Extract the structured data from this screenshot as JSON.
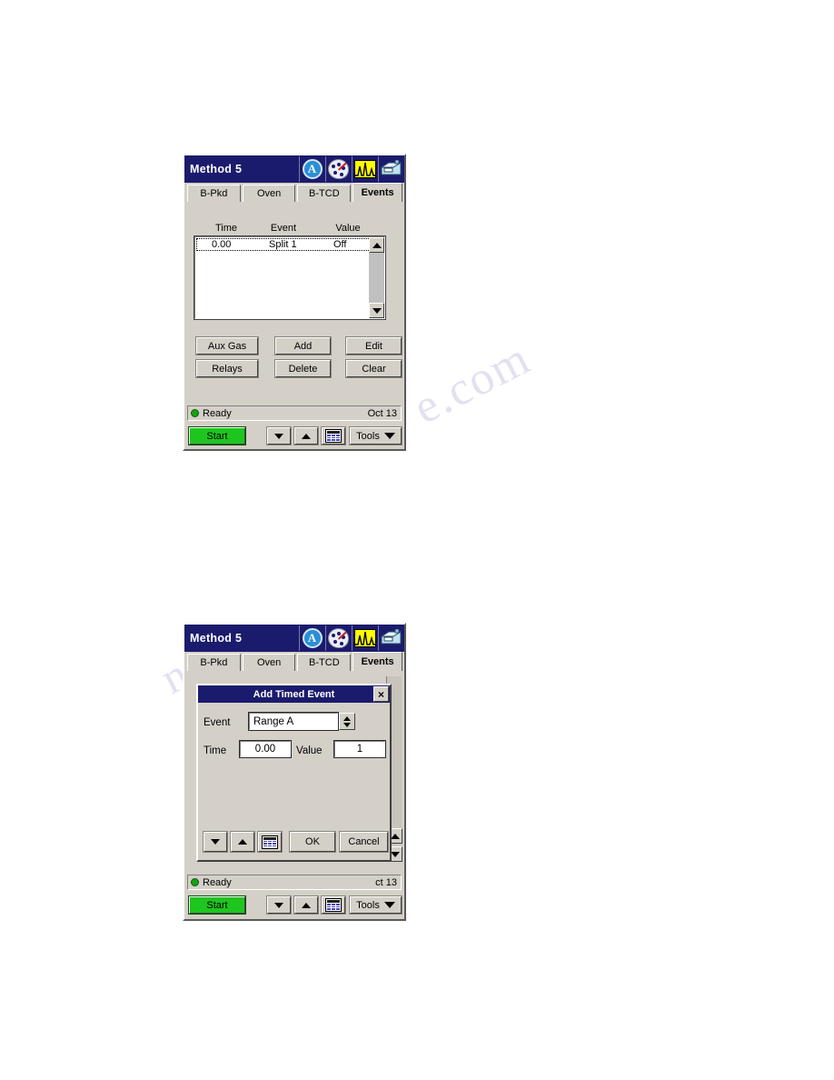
{
  "watermark": {
    "line1": "e.com",
    "line2": "nals"
  },
  "panel_top": {
    "titlebar": {
      "title": "Method 5",
      "icons": [
        {
          "name": "circle-a-icon",
          "glyph": "A"
        },
        {
          "name": "palette-icon",
          "glyph": ""
        },
        {
          "name": "chromatogram-peaks-icon",
          "glyph": ""
        },
        {
          "name": "instrument-icon",
          "glyph": ""
        }
      ]
    },
    "tabs": [
      {
        "label": "B-Pkd",
        "active": false
      },
      {
        "label": "Oven",
        "active": false
      },
      {
        "label": "B-TCD",
        "active": false
      },
      {
        "label": "Events",
        "active": true
      }
    ],
    "table": {
      "headers": [
        "Time",
        "Event",
        "Value"
      ],
      "rows": [
        {
          "time": "0.00",
          "event": "Split 1",
          "value": "Off"
        }
      ]
    },
    "buttons": [
      {
        "label": "Aux Gas"
      },
      {
        "label": "Add"
      },
      {
        "label": "Edit"
      },
      {
        "label": "Relays"
      },
      {
        "label": "Delete"
      },
      {
        "label": "Clear"
      }
    ],
    "status": {
      "text": "Ready",
      "date": "Oct 13",
      "led_color": "#18a018"
    },
    "toolbar": {
      "start_label": "Start",
      "start_color": "#1fc51f",
      "tools_label": "Tools",
      "down_icon": "arrow-down-icon",
      "up_icon": "arrow-up-icon",
      "keypad_icon": "keypad-icon"
    }
  },
  "panel_bottom": {
    "titlebar": {
      "title": "Method 5"
    },
    "tabs": [
      {
        "label": "B-Pkd",
        "active": false
      },
      {
        "label": "Oven",
        "active": false
      },
      {
        "label": "B-TCD",
        "active": false
      },
      {
        "label": "Events",
        "active": true
      }
    ],
    "dialog": {
      "title": "Add Timed Event",
      "close_label": "×",
      "event_label": "Event",
      "event_value": "Range A",
      "time_label": "Time",
      "time_value": "0.00",
      "value_label": "Value",
      "value_value": "1",
      "ok_label": "OK",
      "cancel_label": "Cancel",
      "down_icon": "arrow-down-icon",
      "up_icon": "arrow-up-icon",
      "keypad_icon": "keypad-icon"
    },
    "status": {
      "text": "Ready",
      "date": "ct 13",
      "led_color": "#18a018"
    },
    "toolbar": {
      "start_label": "Start",
      "start_color": "#1fc51f",
      "tools_label": "Tools"
    }
  }
}
